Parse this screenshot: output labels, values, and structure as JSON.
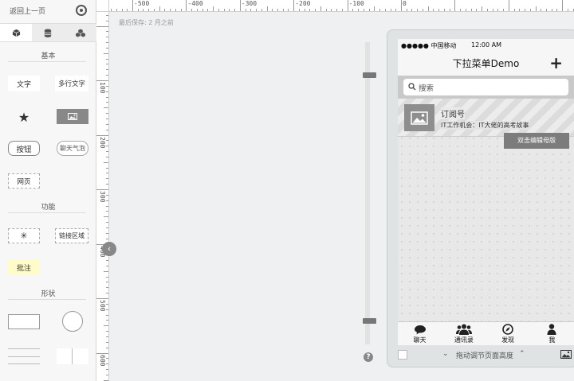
{
  "left_panel": {
    "back_label": "返回上一页",
    "sections": {
      "basic": "基本",
      "function": "功能",
      "shape": "形状"
    },
    "widgets": {
      "text": "文字",
      "multiline_text": "多行文字",
      "button": "按钮",
      "chat_bubble": "聊天气泡",
      "webpage": "网页",
      "link_area": "链接区域",
      "note": "批注"
    }
  },
  "canvas": {
    "last_saved": "最后保存: 2 月之前",
    "ruler_h": [
      "-500",
      "-400",
      "-300",
      "-200",
      "-100",
      "0"
    ],
    "ruler_v": [
      "100",
      "200",
      "300",
      "400",
      "500",
      "600"
    ],
    "drag_hint": "拖动调节页面高度",
    "master_button": "双击编辑母版"
  },
  "phone": {
    "carrier": "●●●●● 中国移动",
    "time": "12:00 AM",
    "nav_title": "下拉菜单Demo",
    "search_placeholder": "搜索",
    "list_item": {
      "title": "订阅号",
      "subtitle": "IT工作机会：IT大佬的高考故事"
    },
    "tabs": [
      {
        "label": "聊天"
      },
      {
        "label": "通讯录"
      },
      {
        "label": "发现"
      },
      {
        "label": "我"
      }
    ]
  }
}
